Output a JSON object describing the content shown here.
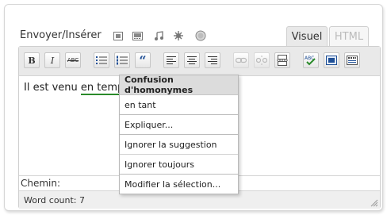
{
  "header": {
    "upload_label": "Envoyer/Insérer",
    "media_icons": [
      "image-icon",
      "video-icon",
      "audio-icon",
      "media-icon",
      "record-icon"
    ]
  },
  "tabs": [
    {
      "label": "Visuel",
      "active": true
    },
    {
      "label": "HTML",
      "active": false
    }
  ],
  "toolbar": {
    "bold": "B",
    "italic": "I",
    "strike": "ABC",
    "quote": "“"
  },
  "content": {
    "before": "Il est venu ",
    "error_word": "en temps",
    "underline_color": "#2a8a2a"
  },
  "context_menu": {
    "title": "Confusion d'homonymes",
    "suggestion": "en tant",
    "explain": "Expliquer...",
    "ignore_suggestion": "Ignorer la suggestion",
    "ignore_always": "Ignorer toujours",
    "edit_selection": "Modifier la sélection..."
  },
  "path": {
    "label": "Chemin:"
  },
  "status": {
    "word_count": "Word count: 7"
  }
}
